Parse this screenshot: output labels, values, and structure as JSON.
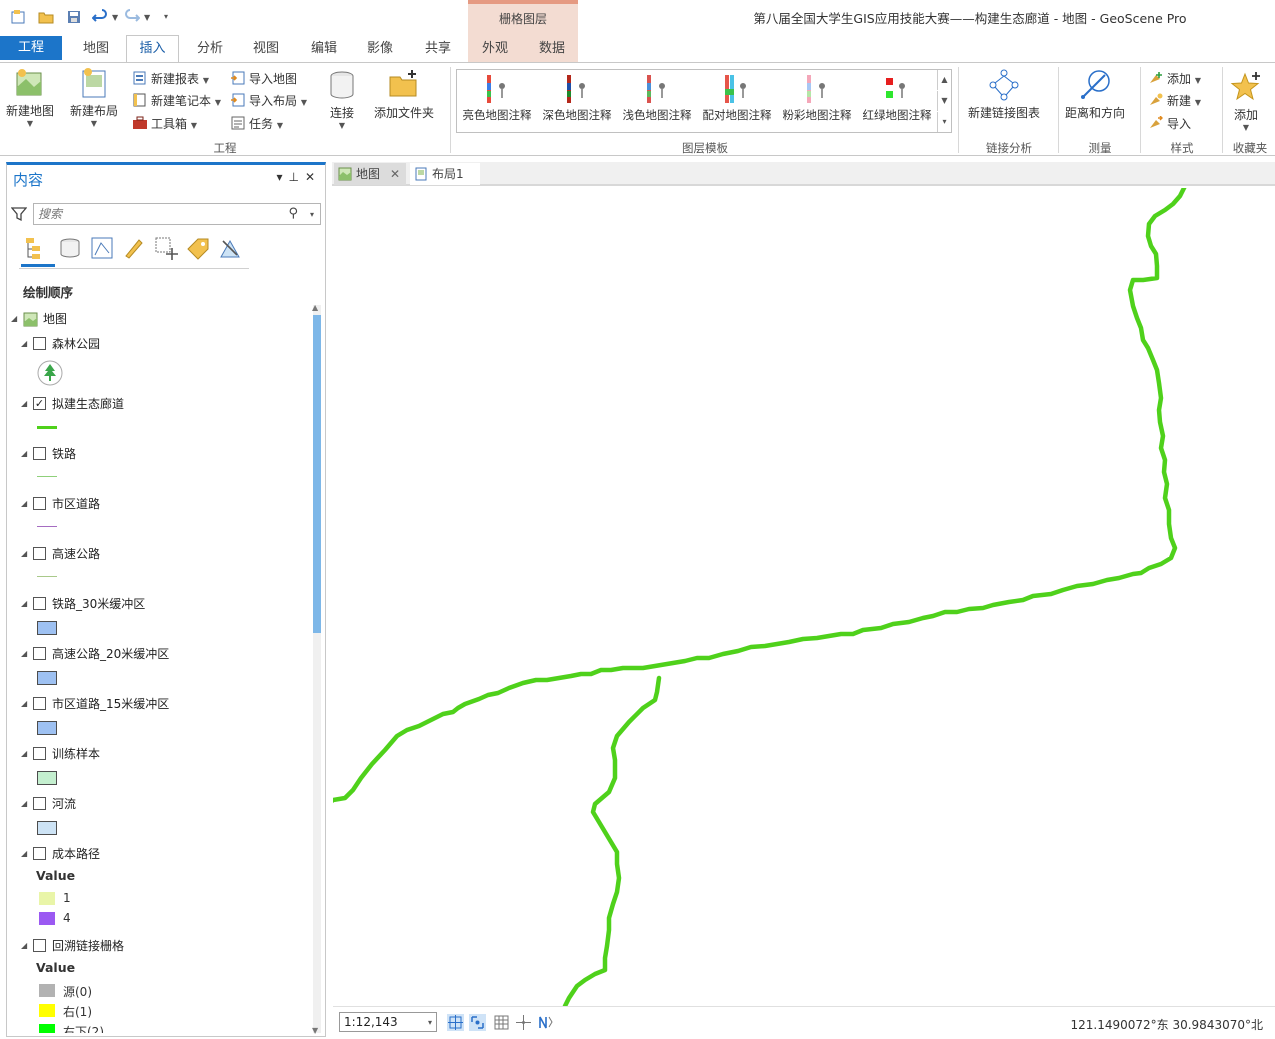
{
  "window": {
    "title": "第八届全国大学生GIS应用技能大赛——构建生态廊道 - 地图 - GeoScene Pro",
    "context_group": "栅格图层"
  },
  "tabs": [
    {
      "label": "工程"
    },
    {
      "label": "地图"
    },
    {
      "label": "插入"
    },
    {
      "label": "分析"
    },
    {
      "label": "视图"
    },
    {
      "label": "编辑"
    },
    {
      "label": "影像"
    },
    {
      "label": "共享"
    },
    {
      "label": "外观"
    },
    {
      "label": "数据"
    }
  ],
  "ribbon": {
    "project_group": {
      "label": "工程",
      "new_map": "新建地图",
      "new_layout": "新建布局",
      "new_report": "新建报表",
      "new_notebook": "新建笔记本",
      "toolbox": "工具箱",
      "import_map": "导入地图",
      "import_layout": "导入布局",
      "task": "任务",
      "connect": "连接",
      "add_folder": "添加文件夹"
    },
    "layer_templates": {
      "label": "图层模板",
      "items": [
        "亮色地图注释",
        "深色地图注释",
        "浅色地图注释",
        "配对地图注释",
        "粉彩地图注释",
        "红绿地图注释"
      ]
    },
    "link_analysis": {
      "label": "链接分析",
      "new_link_chart": "新建链接图表"
    },
    "measure": {
      "label": "测量",
      "distance_direction": "距离和方向"
    },
    "styles": {
      "label": "样式",
      "add": "添加",
      "new": "新建",
      "import": "导入"
    },
    "favorites": {
      "label": "收藏夹",
      "add": "添加"
    }
  },
  "contents": {
    "title": "内容",
    "search_placeholder": "搜索",
    "draw_order": "绘制顺序",
    "map_name": "地图",
    "layers": [
      {
        "name": "森林公园",
        "checked": false,
        "symbol": "tree"
      },
      {
        "name": "拟建生态廊道",
        "checked": true,
        "symbol": "line",
        "color": "#4fd11b"
      },
      {
        "name": "铁路",
        "checked": false,
        "symbol": "line",
        "color": "#8fd07a"
      },
      {
        "name": "市区道路",
        "checked": false,
        "symbol": "line",
        "color": "#a56cc1"
      },
      {
        "name": "高速公路",
        "checked": false,
        "symbol": "line",
        "color": "#a9c98a"
      },
      {
        "name": "铁路_30米缓冲区",
        "checked": false,
        "symbol": "fill",
        "color": "#9ec1f2"
      },
      {
        "name": "高速公路_20米缓冲区",
        "checked": false,
        "symbol": "fill",
        "color": "#9ec1f2"
      },
      {
        "name": "市区道路_15米缓冲区",
        "checked": false,
        "symbol": "fill",
        "color": "#9ec1f2"
      },
      {
        "name": "训练样本",
        "checked": false,
        "symbol": "fill",
        "color": "#c4efcf"
      },
      {
        "name": "河流",
        "checked": false,
        "symbol": "fill",
        "color": "#cde3f5"
      }
    ],
    "cost_path": {
      "name": "成本路径",
      "value_header": "Value",
      "classes": [
        {
          "label": "1",
          "color": "#e9f5a8"
        },
        {
          "label": "4",
          "color": "#9b59f2"
        }
      ]
    },
    "backlink": {
      "name": "回溯链接栅格",
      "value_header": "Value",
      "classes": [
        {
          "label": "源(0)",
          "color": "#b2b2b2"
        },
        {
          "label": "右(1)",
          "color": "#ffff00"
        },
        {
          "label": "右下(2)",
          "color": "#00ff00"
        }
      ]
    }
  },
  "views": {
    "tabs": [
      {
        "label": "地图",
        "closable": true
      },
      {
        "label": "布局1",
        "closable": false
      }
    ]
  },
  "map": {
    "corridor_color": "#4fd11b"
  },
  "status": {
    "scale": "1:12,143",
    "coordinates": "121.1490072°东 30.9843070°北"
  }
}
